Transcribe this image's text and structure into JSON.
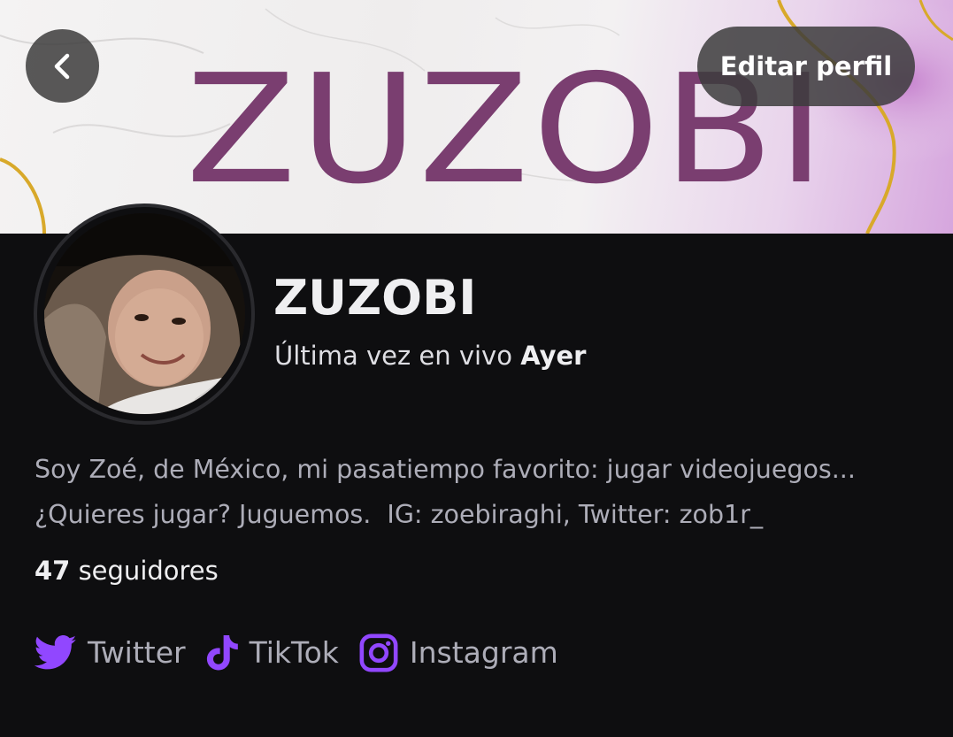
{
  "banner": {
    "title": "ZUZOBI",
    "title_color": "#7a3e70"
  },
  "header": {
    "back_icon": "chevron-left-icon",
    "edit_label": "Editar perfil"
  },
  "profile": {
    "channel_name": "ZUZOBI",
    "last_live_prefix": "Última vez en vivo",
    "last_live_value": "Ayer",
    "bio_line1": "Soy Zoé, de México, mi pasatiempo favorito: jugar videojuegos...",
    "bio_line2": "¿Quieres jugar? Juguemos.  IG: zoebiraghi, Twitter: zob1r_",
    "followers_count": "47",
    "followers_label": "seguidores"
  },
  "socials": [
    {
      "label": "Twitter",
      "icon": "twitter-icon"
    },
    {
      "label": "TikTok",
      "icon": "tiktok-icon"
    },
    {
      "label": "Instagram",
      "icon": "instagram-icon"
    }
  ],
  "colors": {
    "background": "#0e0e10",
    "accent": "#9147ff",
    "text_primary": "#efeff1",
    "text_secondary": "#adadb8"
  }
}
